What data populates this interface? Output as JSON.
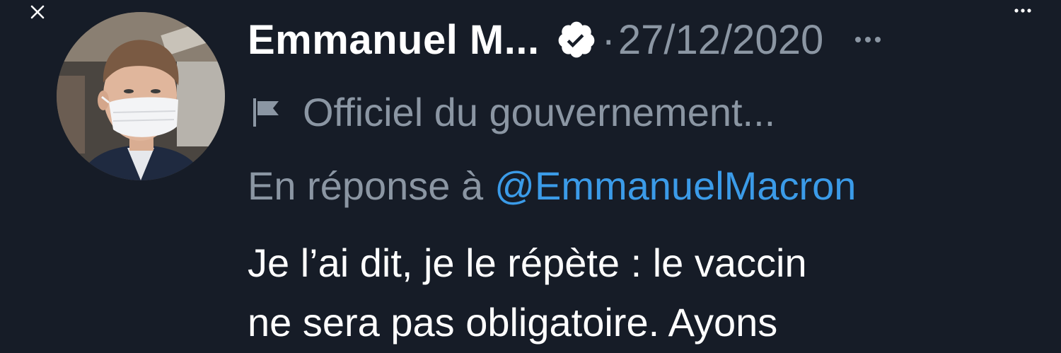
{
  "window": {
    "close_icon": "close-icon",
    "more_icon": "more-horizontal-icon"
  },
  "tweet": {
    "author": {
      "display_name": "Emmanuel M...",
      "verified": true,
      "verified_icon": "verified-badge-icon"
    },
    "separator": "·",
    "date": "27/12/2020",
    "more_icon": "more-horizontal-icon",
    "label": {
      "icon": "flag-icon",
      "text": "Officiel du gouvernement..."
    },
    "reply": {
      "prefix": "En réponse à",
      "mention": "@EmmanuelMacron"
    },
    "body_lines": [
      "Je l’ai dit, je le répète : le vaccin",
      "ne sera pas obligatoire. Ayons"
    ]
  },
  "colors": {
    "background": "#161c27",
    "primary_text": "#ffffff",
    "secondary_text": "#8b96a3",
    "link": "#3b9be8"
  }
}
